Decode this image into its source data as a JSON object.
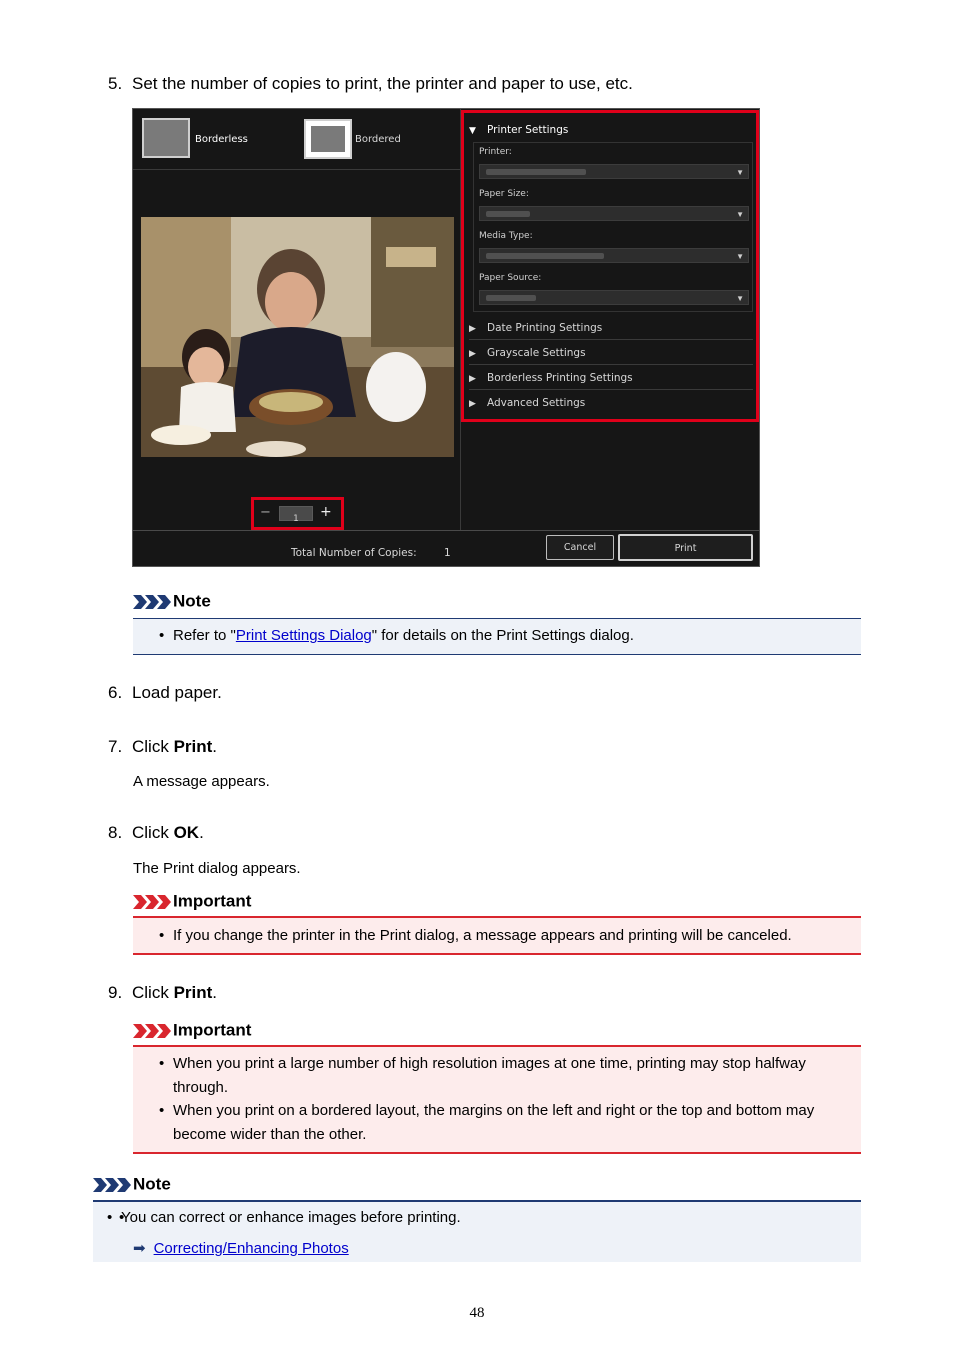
{
  "steps": {
    "s5": {
      "num": "5.",
      "text": "Set the number of copies to print, the printer and paper to use, etc."
    },
    "s6": {
      "num": "6.",
      "text": "Load paper."
    },
    "s7": {
      "num": "7.",
      "pre": "Click ",
      "bold": "Print",
      "post": ".",
      "sub": "A message appears."
    },
    "s8": {
      "num": "8.",
      "pre": "Click ",
      "bold": "OK",
      "post": ".",
      "sub": "The Print dialog appears."
    },
    "s9": {
      "num": "9.",
      "pre": "Click ",
      "bold": "Print",
      "post": "."
    }
  },
  "screenshot": {
    "layout_options": [
      "Borderless",
      "Bordered"
    ],
    "printer_settings_title": "Printer Settings",
    "fields": [
      "Printer:",
      "Paper Size:",
      "Media Type:",
      "Paper Source:"
    ],
    "sections": [
      "Date Printing Settings",
      "Grayscale Settings",
      "Borderless Printing Settings",
      "Advanced Settings"
    ],
    "copies_value": "1",
    "minus": "−",
    "plus": "+",
    "total_label": "Total Number of Copies:",
    "total_value": "1",
    "cancel": "Cancel",
    "print": "Print"
  },
  "note1": {
    "title": "Note",
    "pre": "Refer to \"",
    "link": "Print Settings Dialog",
    "post": "\" for details on the Print Settings dialog."
  },
  "important1": {
    "title": "Important",
    "items": [
      "If you change the printer in the Print dialog, a message appears and printing will be canceled."
    ]
  },
  "important2": {
    "title": "Important",
    "items": [
      "When you print a large number of high resolution images at one time, printing may stop halfway through.",
      "When you print on a bordered layout, the margins on the left and right or the top and bottom may become wider than the other."
    ]
  },
  "note2": {
    "title": "Note",
    "item": "You can correct or enhance images before printing.",
    "link": "Correcting/Enhancing Photos"
  },
  "page_number": "48",
  "colors": {
    "note_accent": "#1f3a73",
    "important_accent": "#d9262e",
    "highlight_red": "#e0001a"
  }
}
